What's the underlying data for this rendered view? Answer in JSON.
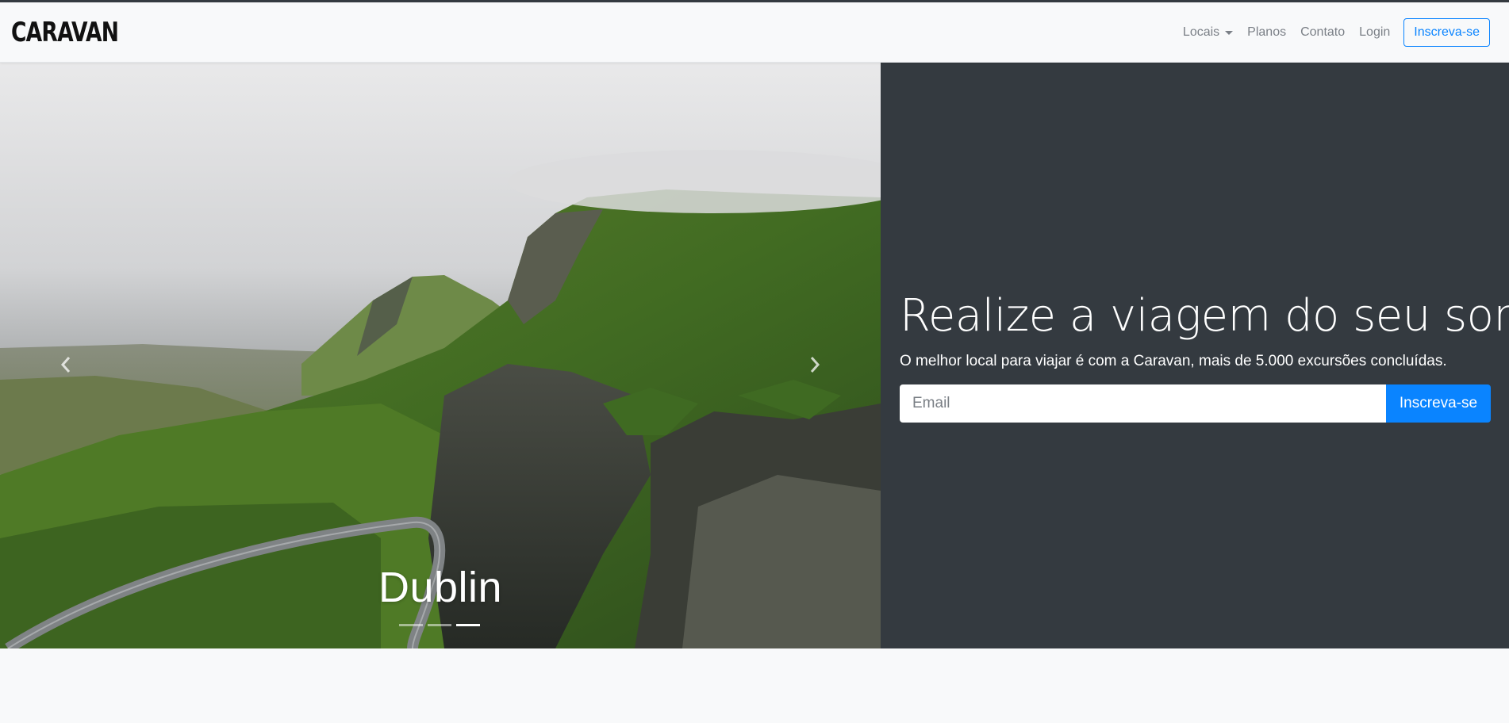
{
  "navbar": {
    "brand": "CARAVAN",
    "links": [
      {
        "label": "Locais",
        "dropdown": true
      },
      {
        "label": "Planos"
      },
      {
        "label": "Contato"
      },
      {
        "label": "Login"
      }
    ],
    "cta_label": "Inscreva-se"
  },
  "carousel": {
    "caption": "Dublin",
    "slides": 3,
    "active_slide": 3,
    "prev_icon": "chevron-left-icon",
    "next_icon": "chevron-right-icon"
  },
  "hero": {
    "headline": "Realize a viagem do seu sonho",
    "lead": "O melhor local para viajar é com a Caravan, mais de 5.000 excursões concluídas.",
    "email_placeholder": "Email",
    "button_label": "Inscreva-se"
  },
  "colors": {
    "primary": "#0a84ff",
    "dark_panel": "#343a40",
    "navbar_bg": "#f8f9fa"
  }
}
